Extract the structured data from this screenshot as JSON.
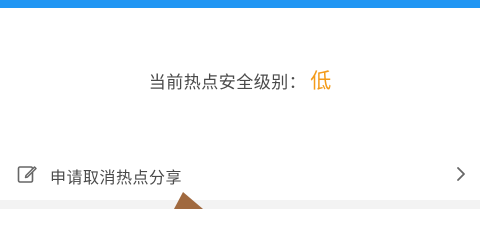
{
  "security": {
    "label": "当前热点安全级别：",
    "value": "低",
    "value_color": "#f39b1a"
  },
  "action": {
    "label": "申请取消热点分享",
    "icon": "edit-icon",
    "trailing_icon": "chevron-right-icon"
  },
  "theme": {
    "accent": "#2196f3"
  }
}
